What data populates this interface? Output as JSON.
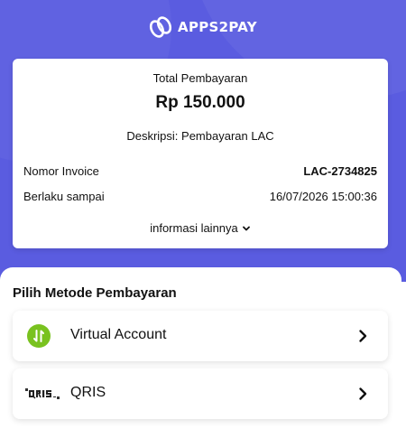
{
  "brand": {
    "name": "APPS2PAY",
    "logo_icon": "apps2pay-logo-icon",
    "hero_color": "#5a5ce0"
  },
  "summary": {
    "total_label": "Total Pembayaran",
    "amount": "Rp 150.000",
    "description": "Deskripsi: Pembayaran LAC",
    "invoice_label": "Nomor Invoice",
    "invoice_value": "LAC-2734825",
    "valid_label": "Berlaku sampai",
    "valid_value": "16/07/2026 15:00:36",
    "more_info": "informasi lainnya",
    "more_info_icon": "chevron-down-icon"
  },
  "payment_methods": {
    "title": "Pilih Metode Pembayaran",
    "items": [
      {
        "label": "Virtual Account",
        "icon": "virtual-account-icon",
        "icon_color": "#79c21f",
        "action_icon": "chevron-right-icon"
      },
      {
        "label": "QRIS",
        "icon": "qris-logo-icon",
        "action_icon": "chevron-right-icon"
      }
    ]
  }
}
